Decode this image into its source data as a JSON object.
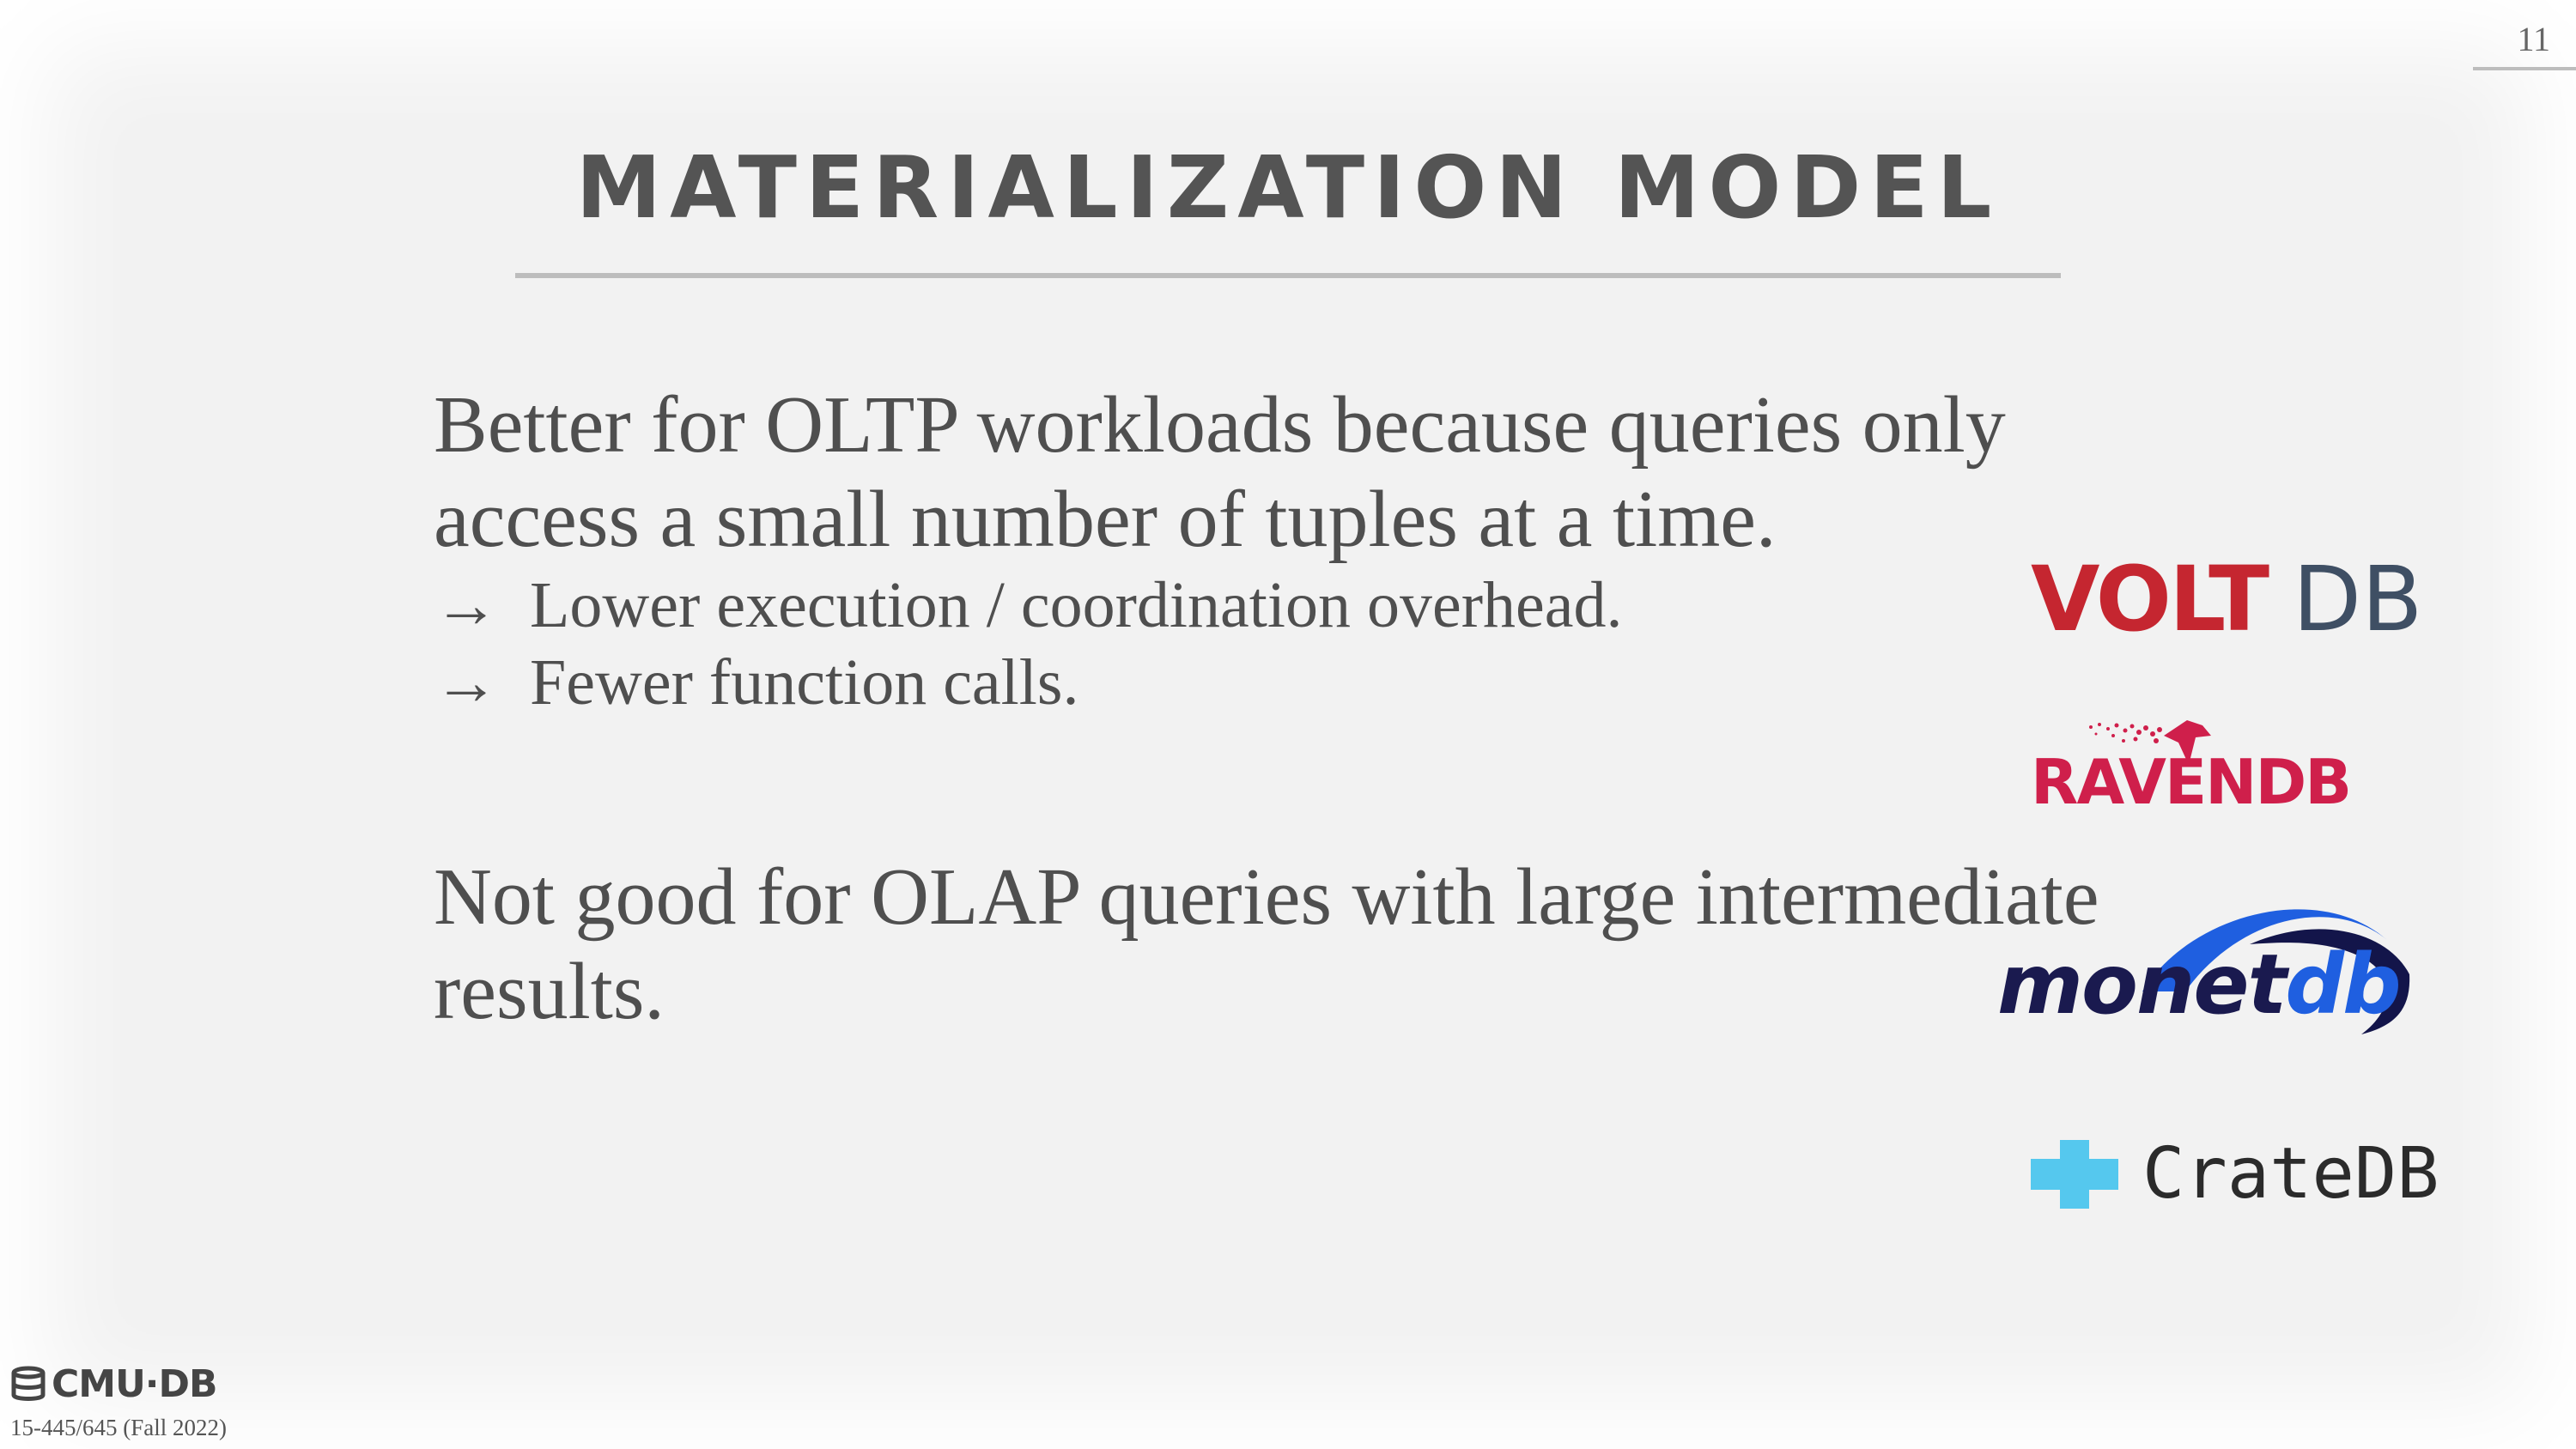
{
  "slide": {
    "page_number": "11",
    "title": "MATERIALIZATION MODEL",
    "paragraph1": "Better for OLTP workloads because queries only access a small number of tuples at a time.",
    "bullets": [
      {
        "arrow": "→",
        "text": "Lower execution / coordination overhead."
      },
      {
        "arrow": "→",
        "text": "Fewer function calls."
      }
    ],
    "paragraph2": "Not good for OLAP queries with large intermediate results."
  },
  "logos": {
    "voltdb": {
      "part1": "VOLT",
      "part2": "DB",
      "colors": [
        "#c52630",
        "#3f4f64"
      ]
    },
    "ravendb": {
      "text": "RAVENDB",
      "color": "#cf1f4b"
    },
    "monetdb": {
      "part1": "monet",
      "part2": "db",
      "colors": [
        "#1a1a4f",
        "#1f5fe0"
      ]
    },
    "cratedb": {
      "text": "CrateDB",
      "icon_color": "#55c8ee"
    }
  },
  "footer": {
    "logo_text": "CMU·DB",
    "course": "15-445/645 (Fall 2022)"
  }
}
